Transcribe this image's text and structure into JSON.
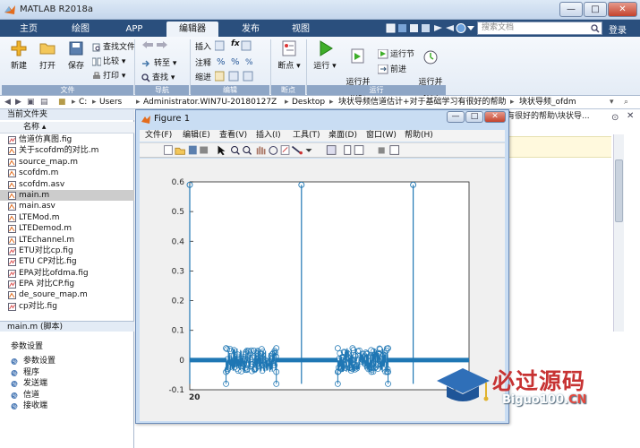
{
  "app": {
    "title": "MATLAB R2018a"
  },
  "window_buttons": {
    "minimize": "—",
    "maximize": "□",
    "close": "✕"
  },
  "tabs": [
    "主页",
    "绘图",
    "APP",
    "编辑器",
    "发布",
    "视图"
  ],
  "search": {
    "placeholder": "搜索文档"
  },
  "login": "登录",
  "ribbon": {
    "new": "新建",
    "open": "打开",
    "save": "保存",
    "find_files": "查找文件",
    "compare": "比较",
    "print": "打印",
    "goto": "转至",
    "find": "查找",
    "insert": "插入",
    "comment": "注释",
    "indent": "缩进",
    "fx": "fx",
    "breakpoints": "断点",
    "run": "运行",
    "run_advance": "运行并\n前进",
    "run_section": "运行节",
    "advance": "前进",
    "run_time": "运行并\n计时",
    "groups": {
      "file": "文件",
      "navigate": "导航",
      "edit": "编辑",
      "breakpoints": "断点",
      "run": "运行"
    }
  },
  "address": {
    "parts": [
      "C:",
      "Users",
      "Administrator.WIN7U-20180127Z",
      "Desktop",
      "块状导频信道估计+对于基础学习有很好的帮助",
      "块状导频_ofdm"
    ]
  },
  "left_panel": {
    "header": "当前文件夹",
    "column": "名称",
    "files": [
      "信道仿真图.fig",
      "关于scofdm的对比.m",
      "source_map.m",
      "scofdm.m",
      "scofdm.asv",
      "main.m",
      "main.asv",
      "LTEMod.m",
      "LTEDemod.m",
      "LTEchannel.m",
      "ETU对比cp.fig",
      "ETU CP对比.fig",
      "EPA对比ofdma.fig",
      "EPA 对比CP.fig",
      "de_soure_map.m",
      "cp对比.fig"
    ],
    "selected_index": 5,
    "details_header": "main.m  (脚本)",
    "details_title": "参数设置",
    "sections": [
      "参数设置",
      "程序",
      "发送端",
      "信道",
      "接收端"
    ]
  },
  "editor": {
    "tab_text": "有很好的帮助\\块状导..."
  },
  "figure": {
    "title": "Figure 1",
    "menu": [
      "文件(F)",
      "编辑(E)",
      "查看(V)",
      "插入(I)",
      "工具(T)",
      "桌面(D)",
      "窗口(W)",
      "帮助(H)"
    ],
    "yticks": [
      "0.6",
      "0.5",
      "0.4",
      "0.3",
      "0.2",
      "0.1",
      "0",
      "-0.1"
    ],
    "xtick_label": "20"
  },
  "chart_data": {
    "type": "line",
    "title": "",
    "xlabel": "",
    "ylabel": "",
    "ylim": [
      -0.1,
      0.6
    ],
    "xlim": [
      0,
      100
    ],
    "tick_labels_y": [
      0.6,
      0.5,
      0.4,
      0.3,
      0.2,
      0.1,
      0,
      -0.1
    ],
    "spike_positions": [
      0,
      40,
      80
    ],
    "spike_values": [
      0.59,
      0.59,
      0.59
    ],
    "noise_segments": [
      [
        13,
        31
      ],
      [
        53,
        71
      ]
    ],
    "noise_amplitude": 0.04,
    "flat_segments": [
      [
        0,
        13
      ],
      [
        31,
        53
      ],
      [
        71,
        100
      ]
    ],
    "flat_value": 0.0,
    "extra_stems": [
      {
        "x": 13,
        "y": -0.08
      },
      {
        "x": 31,
        "y": -0.08
      },
      {
        "x": 53,
        "y": -0.08
      },
      {
        "x": 71,
        "y": -0.08
      }
    ],
    "series_color": "#1f77b4"
  },
  "watermark": {
    "line1": "必过源码",
    "line2a": "Biguo100.",
    "line2b": "CN"
  },
  "colors": {
    "accent": "#2a4f7d",
    "plot": "#1f77b4"
  }
}
